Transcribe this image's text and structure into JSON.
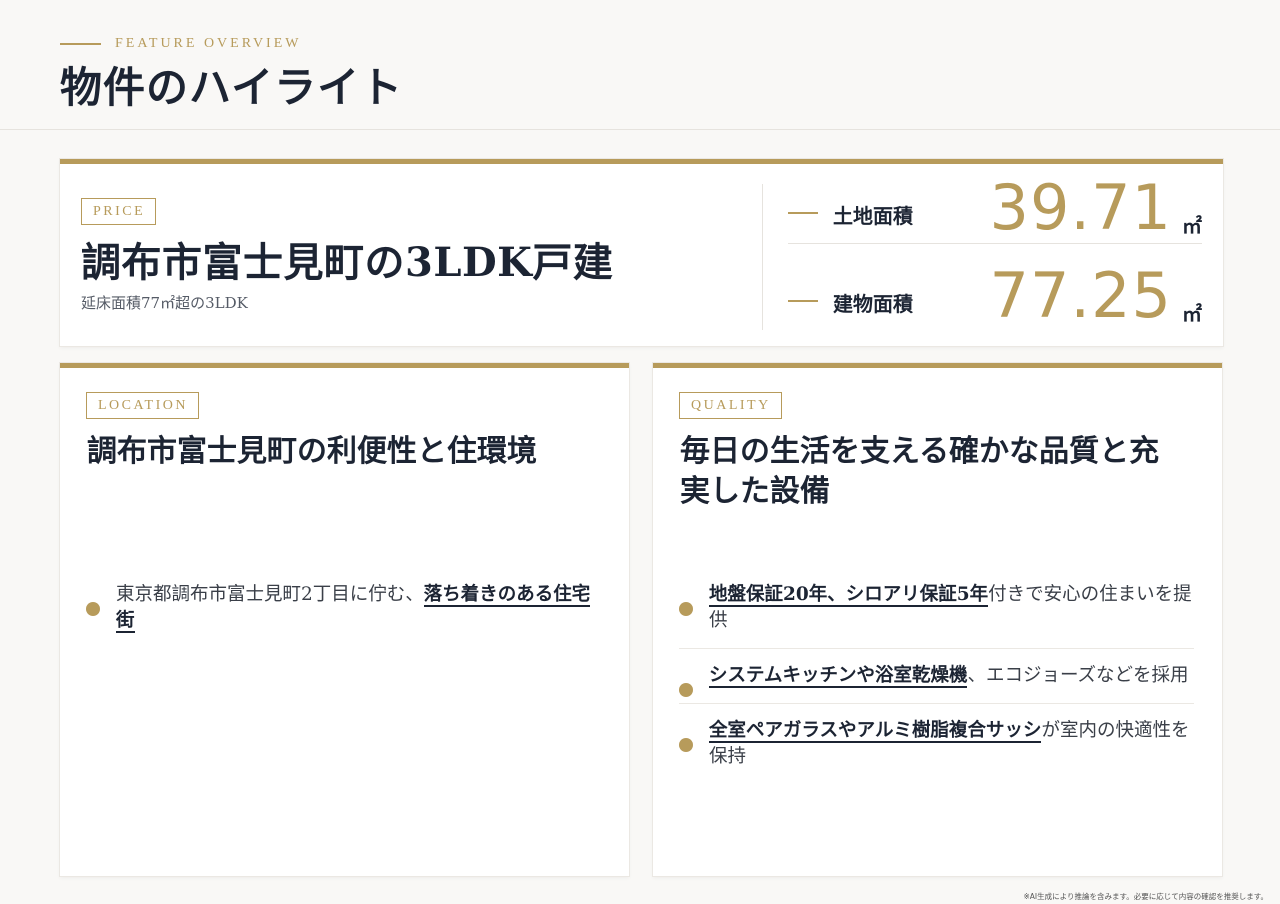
{
  "header": {
    "eyebrow": "FEATURE OVERVIEW",
    "title": "物件のハイライト"
  },
  "price_card": {
    "tag": "PRICE",
    "title": "調布市富士見町の3LDK戸建",
    "subtitle": "延床面積77㎡超の3LDK",
    "stats": [
      {
        "label": "土地面積",
        "value": "39.71",
        "unit": "㎡"
      },
      {
        "label": "建物面積",
        "value": "77.25",
        "unit": "㎡"
      }
    ]
  },
  "location_card": {
    "tag": "LOCATION",
    "title": "調布市富士見町の利便性と住環境",
    "bullets": [
      {
        "pre": "東京都調布市富士見町2丁目に佇む、",
        "hl": "落ち着きのある住宅街",
        "post": ""
      }
    ]
  },
  "quality_card": {
    "tag": "QUALITY",
    "title": "毎日の生活を支える確かな品質と充実した設備",
    "bullets": [
      {
        "pre": "",
        "hl": "地盤保証20年、シロアリ保証5年",
        "post": "付きで安心の住まいを提供"
      },
      {
        "pre": "",
        "hl": "システムキッチンや浴室乾燥機",
        "post": "、エコジョーズなどを採用"
      },
      {
        "pre": "",
        "hl": "全室ペアガラスやアルミ樹脂複合サッシ",
        "post": "が室内の快適性を保持"
      }
    ]
  },
  "footnote": "※AI生成により推論を含みます。必要に応じて内容の確認を推奨します。",
  "colors": {
    "accent": "#b79b5b",
    "text": "#1c2433",
    "background": "#f9f8f6"
  }
}
